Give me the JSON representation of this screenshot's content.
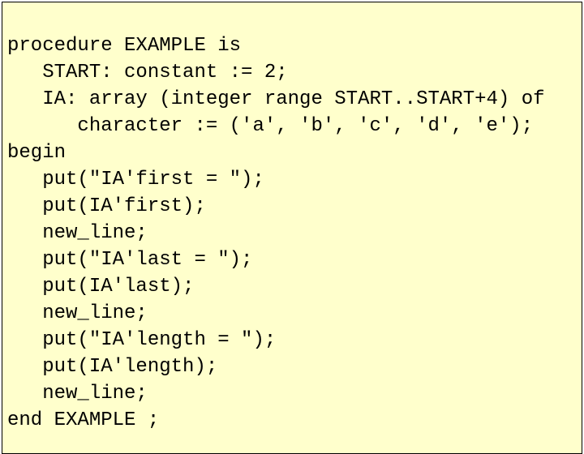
{
  "code": {
    "lines": [
      "procedure EXAMPLE is",
      "   START: constant := 2;",
      "   IA: array (integer range START..START+4) of",
      "      character := ('a', 'b', 'c', 'd', 'e');",
      "begin",
      "   put(\"IA'first = \");",
      "   put(IA'first);",
      "   new_line;",
      "   put(\"IA'last = \");",
      "   put(IA'last);",
      "   new_line;",
      "   put(\"IA'length = \");",
      "   put(IA'length);",
      "   new_line;",
      "end EXAMPLE ;"
    ]
  }
}
